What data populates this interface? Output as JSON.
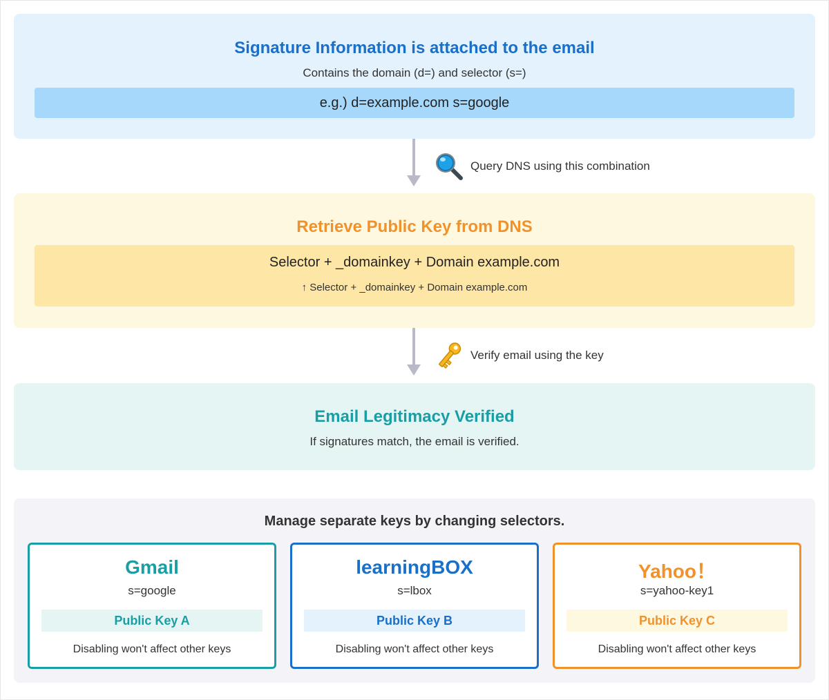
{
  "step1": {
    "title": "Signature Information is attached to the email",
    "subtitle": "Contains the domain (d=) and selector (s=)",
    "example": "e.g.) d=example.com s=google",
    "title_color": "#1a6fc9"
  },
  "transition1": {
    "icon": "magnifying-glass-icon",
    "text": "Query DNS using this combination"
  },
  "step2": {
    "title": "Retrieve Public Key from DNS",
    "line1": "Selector + _domainkey + Domain example.com",
    "line2": "↑ Selector + _domainkey + Domain example.com",
    "title_color": "#f0922b"
  },
  "transition2": {
    "icon": "key-icon",
    "text": "Verify email using the key"
  },
  "step3": {
    "title": "Email Legitimacy Verified",
    "subtitle": "If signatures match, the email is verified.",
    "title_color": "#1a9ea5"
  },
  "selectors": {
    "heading": "Manage separate keys by changing selectors.",
    "cards": [
      {
        "name": "Gmail",
        "selector": "s=google",
        "key": "Public Key A",
        "note": "Disabling won't affect other keys",
        "color": "#1a9ea5",
        "key_bg": "#e5f5f3"
      },
      {
        "name": "learningBOX",
        "selector": "s=lbox",
        "key": "Public Key B",
        "note": "Disabling won't affect other keys",
        "color": "#1a6fc9",
        "key_bg": "#e3f2fd"
      },
      {
        "name": "Yahoo！",
        "selector": "s=yahoo-key1",
        "key": "Public Key C",
        "note": "Disabling won't affect other keys",
        "color": "#f0922b",
        "key_bg": "#fff8e1"
      }
    ]
  }
}
